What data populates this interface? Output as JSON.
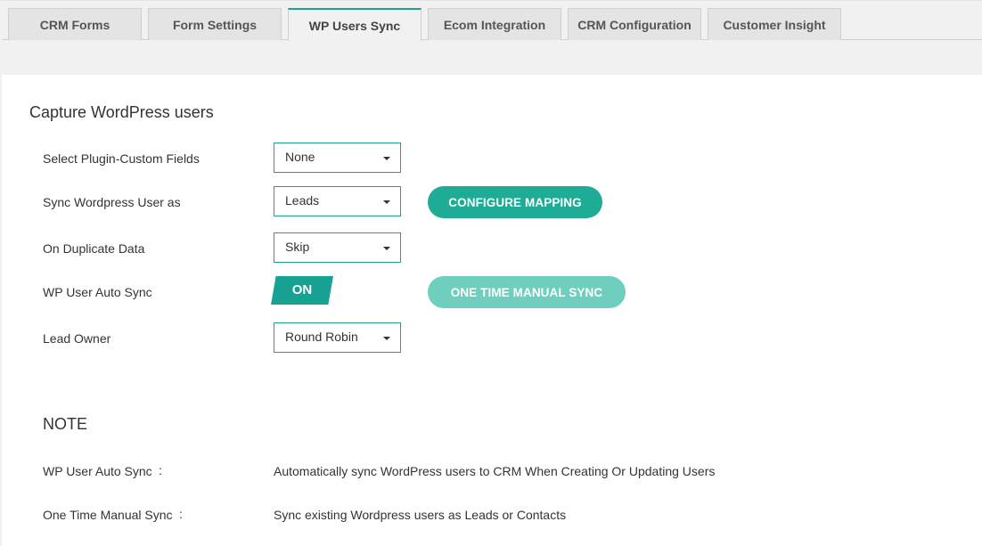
{
  "tabs": [
    {
      "label": "CRM Forms",
      "active": false
    },
    {
      "label": "Form Settings",
      "active": false
    },
    {
      "label": "WP Users Sync",
      "active": true
    },
    {
      "label": "Ecom Integration",
      "active": false
    },
    {
      "label": "CRM Configuration",
      "active": false
    },
    {
      "label": "Customer Insight",
      "active": false
    }
  ],
  "section": {
    "title": "Capture WordPress users"
  },
  "fields": {
    "plugin_custom_fields": {
      "label": "Select Plugin-Custom Fields",
      "value": "None"
    },
    "sync_user_as": {
      "label": "Sync Wordpress User as",
      "value": "Leads"
    },
    "on_duplicate": {
      "label": "On Duplicate Data",
      "value": "Skip"
    },
    "auto_sync": {
      "label": "WP User Auto Sync",
      "toggle_text": "ON"
    },
    "lead_owner": {
      "label": "Lead Owner",
      "value": "Round Robin"
    }
  },
  "buttons": {
    "configure_mapping": "CONFIGURE MAPPING",
    "one_time_manual_sync": "ONE TIME MANUAL SYNC"
  },
  "note": {
    "title": "NOTE",
    "items": [
      {
        "label": "WP User Auto Sync",
        "colon": ":",
        "description": "Automatically sync WordPress users to CRM When Creating Or Updating Users"
      },
      {
        "label": "One Time Manual Sync",
        "colon": ":",
        "description": "Sync existing Wordpress users as Leads or Contacts"
      }
    ]
  },
  "colors": {
    "accent": "#1aa391",
    "button": "#1fac97",
    "button_disabled": "#6ecfbe"
  }
}
